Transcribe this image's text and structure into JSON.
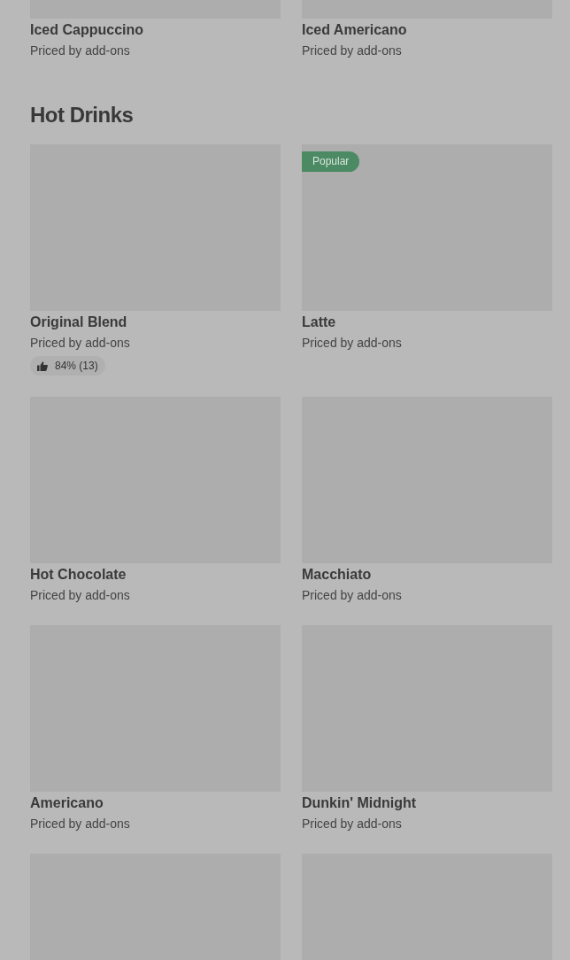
{
  "sections": [
    {
      "rows": [
        {
          "items": [
            {
              "kind": "product",
              "name": "Iced Cappuccino",
              "price": "Priced by add-ons"
            },
            {
              "kind": "product",
              "name": "Iced Americano",
              "price": "Priced by add-ons"
            }
          ]
        }
      ]
    },
    {
      "title": "Hot Drinks",
      "rows": [
        {
          "items": [
            {
              "kind": "product",
              "name": "Original Blend",
              "price": "Priced by add-ons",
              "rating": "84% (13)"
            },
            {
              "kind": "product",
              "name": "Latte",
              "price": "Priced by add-ons",
              "badge": "Popular"
            }
          ]
        },
        {
          "items": [
            {
              "kind": "product",
              "name": "Hot Chocolate",
              "price": "Priced by add-ons"
            },
            {
              "kind": "product",
              "name": "Macchiato",
              "price": "Priced by add-ons"
            }
          ]
        },
        {
          "items": [
            {
              "kind": "product",
              "name": "Americano",
              "price": "Priced by add-ons"
            },
            {
              "kind": "product",
              "name": "Dunkin' Midnight",
              "price": "Priced by add-ons"
            }
          ]
        },
        {
          "items": [
            {
              "kind": "image"
            },
            {
              "kind": "image"
            }
          ]
        }
      ]
    }
  ]
}
